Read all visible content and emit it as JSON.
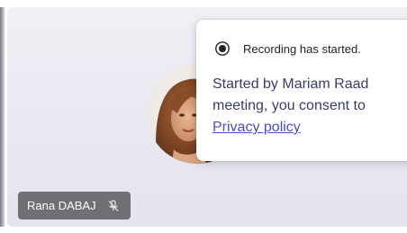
{
  "participant": {
    "name": "Rana DABAJ",
    "mic_icon": "mic-off-icon"
  },
  "notification": {
    "icon": "record-icon",
    "title": "Recording has started.",
    "body_line1": "Started by Mariam Raad",
    "body_line2": "meeting, you consent to",
    "link_text": "Privacy policy"
  },
  "colors": {
    "tile_background": "#ebeaf3",
    "name_badge": "#55555c",
    "link": "#4a4fc4",
    "body_text": "#3b3b6d"
  }
}
